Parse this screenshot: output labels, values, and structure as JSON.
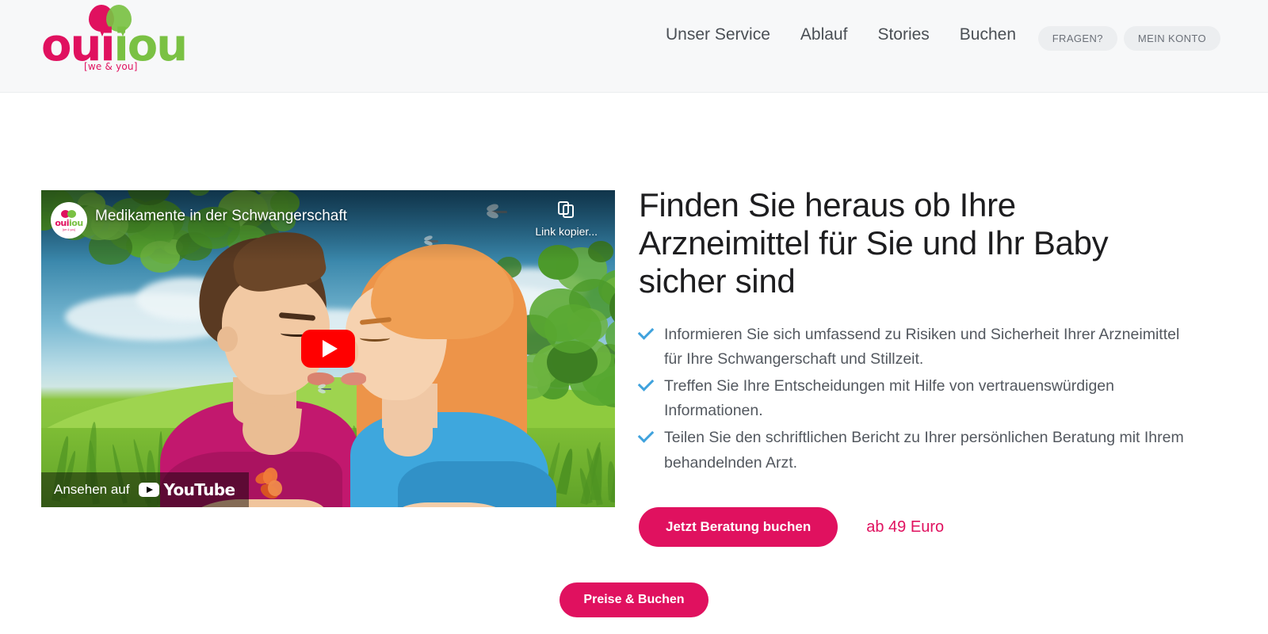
{
  "brand": {
    "logo_word_part1": "oui",
    "logo_word_part2": "iou",
    "tagline": "[we & you]",
    "pink": "#e0115f",
    "green": "#7ac143"
  },
  "header": {
    "nav": [
      {
        "label": "Unser Service"
      },
      {
        "label": "Ablauf"
      },
      {
        "label": "Stories"
      },
      {
        "label": "Buchen"
      }
    ],
    "actions": [
      {
        "label": "FRAGEN?"
      },
      {
        "label": "MEIN KONTO"
      }
    ]
  },
  "video": {
    "title": "Medikamente in der Schwangerschaft",
    "copy_link_label": "Link kopier...",
    "watch_label": "Ansehen auf",
    "platform": "YouTube",
    "play_icon": "play-icon",
    "copy_icon": "copy-icon",
    "avatar_word_part1": "oui",
    "avatar_word_part2": "iou",
    "avatar_tagline": "[we & you]"
  },
  "hero": {
    "heading": "Finden Sie heraus ob Ihre Arzneimittel für Sie und Ihr Baby sicher sind",
    "bullets": [
      "Informieren Sie sich umfassend zu Risiken und Sicherheit Ihrer Arzneimittel für Ihre Schwangerschaft und Stillzeit.",
      "Treffen Sie Ihre Entscheidungen mit Hilfe von vertrauenswürdigen Informationen.",
      "Teilen Sie den schriftlichen Bericht zu Ihrer persönlichen Beratung mit Ihrem behandelnden Arzt."
    ],
    "cta_label": "Jetzt Beratung buchen",
    "price_label": "ab 49 Euro",
    "check_icon": "check-icon",
    "check_color": "#3fa2dd"
  },
  "footer_cta": {
    "label": "Preise & Buchen"
  }
}
